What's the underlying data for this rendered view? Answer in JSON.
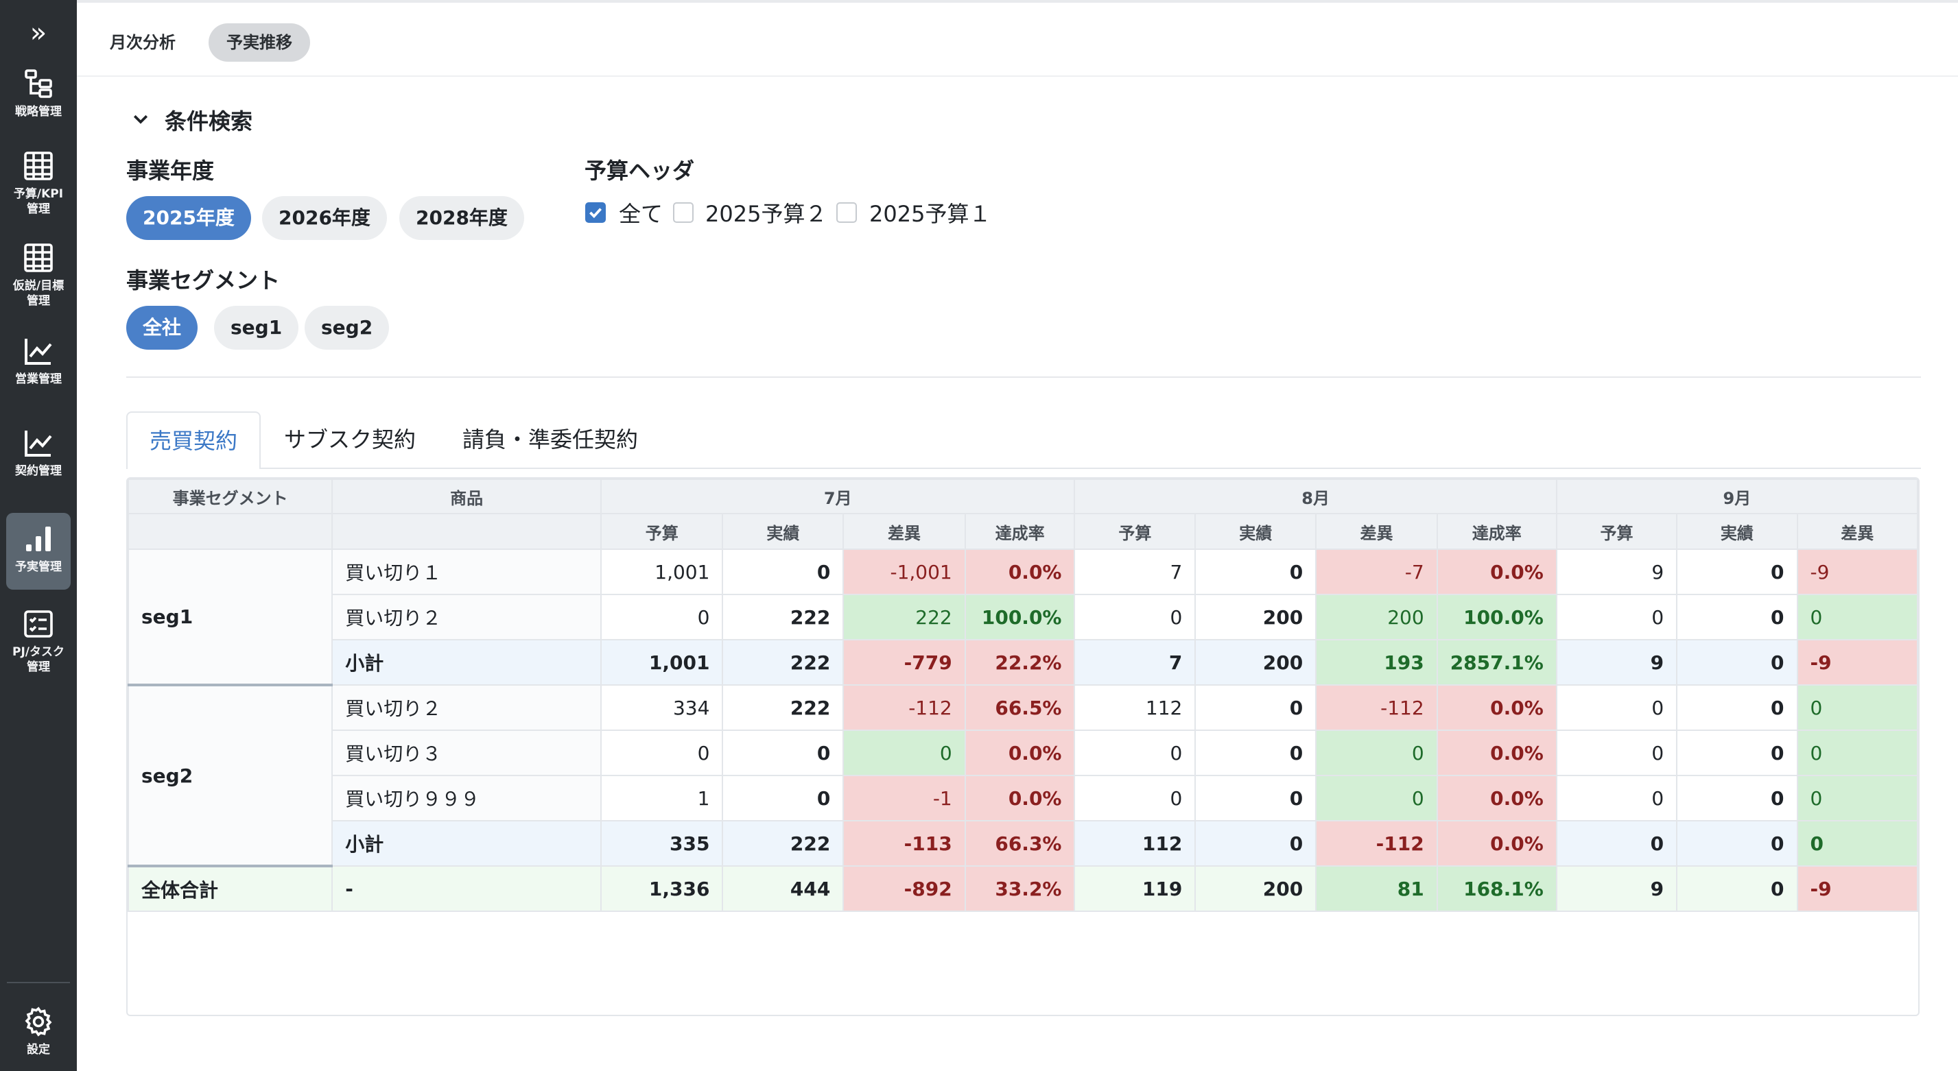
{
  "sidebar": {
    "expand_icon": "chevrons-right-icon",
    "items": [
      {
        "label": "戦略管理",
        "icon": "hierarchy-icon",
        "active": false
      },
      {
        "label": "予算/KPI\n管理",
        "icon": "table-icon",
        "active": false
      },
      {
        "label": "仮説/目標\n管理",
        "icon": "table-icon",
        "active": false
      },
      {
        "label": "営業管理",
        "icon": "line-chart-icon",
        "active": false
      },
      {
        "label": "契約管理",
        "icon": "line-chart-icon",
        "active": false
      },
      {
        "label": "予実管理",
        "icon": "bar-chart-icon",
        "active": true
      },
      {
        "label": "PJ/タスク\n管理",
        "icon": "checklist-icon",
        "active": false
      }
    ],
    "settings": {
      "label": "設定",
      "icon": "gear-icon"
    }
  },
  "topbar": {
    "tabs": [
      {
        "label": "月次分析",
        "active": false
      },
      {
        "label": "予実推移",
        "active": true
      }
    ]
  },
  "search": {
    "title": "条件検索",
    "fiscal_year": {
      "label": "事業年度",
      "options": [
        "2025年度",
        "2026年度",
        "2028年度"
      ],
      "selected": "2025年度"
    },
    "budget_header": {
      "label": "予算ヘッダ",
      "options": [
        {
          "label": "全て",
          "checked": true
        },
        {
          "label": "2025予算２",
          "checked": false
        },
        {
          "label": "2025予算１",
          "checked": false
        }
      ]
    },
    "segment": {
      "label": "事業セグメント",
      "options": [
        "全社",
        "seg1",
        "seg2"
      ],
      "selected": "全社"
    }
  },
  "contract_tabs": [
    {
      "label": "売買契約",
      "active": true
    },
    {
      "label": "サブスク契約",
      "active": false
    },
    {
      "label": "請負・準委任契約",
      "active": false
    }
  ],
  "table": {
    "col_segment": "事業セグメント",
    "col_product": "商品",
    "months": [
      "7月",
      "8月",
      "9月"
    ],
    "metrics": [
      "予算",
      "実績",
      "差異",
      "達成率"
    ],
    "rows": {
      "r1": {
        "segment": "seg1",
        "product": "買い切り１",
        "m7": [
          "1,001",
          "0",
          "-1,001",
          "0.0%"
        ],
        "m8": [
          "7",
          "0",
          "-7",
          "0.0%"
        ],
        "m9": [
          "9",
          "0",
          "-9"
        ]
      },
      "r2": {
        "product": "買い切り２",
        "m7": [
          "0",
          "222",
          "222",
          "100.0%"
        ],
        "m8": [
          "0",
          "200",
          "200",
          "100.0%"
        ],
        "m9": [
          "0",
          "0",
          "0"
        ]
      },
      "r3": {
        "product": "小計",
        "m7": [
          "1,001",
          "222",
          "-779",
          "22.2%"
        ],
        "m8": [
          "7",
          "200",
          "193",
          "2857.1%"
        ],
        "m9": [
          "9",
          "0",
          "-9"
        ]
      },
      "r4": {
        "segment": "seg2",
        "product": "買い切り２",
        "m7": [
          "334",
          "222",
          "-112",
          "66.5%"
        ],
        "m8": [
          "112",
          "0",
          "-112",
          "0.0%"
        ],
        "m9": [
          "0",
          "0",
          "0"
        ]
      },
      "r5": {
        "product": "買い切り３",
        "m7": [
          "0",
          "0",
          "0",
          "0.0%"
        ],
        "m8": [
          "0",
          "0",
          "0",
          "0.0%"
        ],
        "m9": [
          "0",
          "0",
          "0"
        ]
      },
      "r6": {
        "product": "買い切り９９９",
        "m7": [
          "1",
          "0",
          "-1",
          "0.0%"
        ],
        "m8": [
          "0",
          "0",
          "0",
          "0.0%"
        ],
        "m9": [
          "0",
          "0",
          "0"
        ]
      },
      "r7": {
        "product": "小計",
        "m7": [
          "335",
          "222",
          "-113",
          "66.3%"
        ],
        "m8": [
          "112",
          "0",
          "-112",
          "0.0%"
        ],
        "m9": [
          "0",
          "0",
          "0"
        ]
      },
      "r8": {
        "segment": "全体合計",
        "product": "-",
        "m7": [
          "1,336",
          "444",
          "-892",
          "33.2%"
        ],
        "m8": [
          "119",
          "200",
          "81",
          "168.1%"
        ],
        "m9": [
          "9",
          "0",
          "-9"
        ]
      }
    }
  },
  "colors": {
    "sidebar_bg": "#2b2f33",
    "accent": "#4a80c9",
    "negative_bg": "#f6d4d4",
    "positive_bg": "#d3efd5"
  }
}
